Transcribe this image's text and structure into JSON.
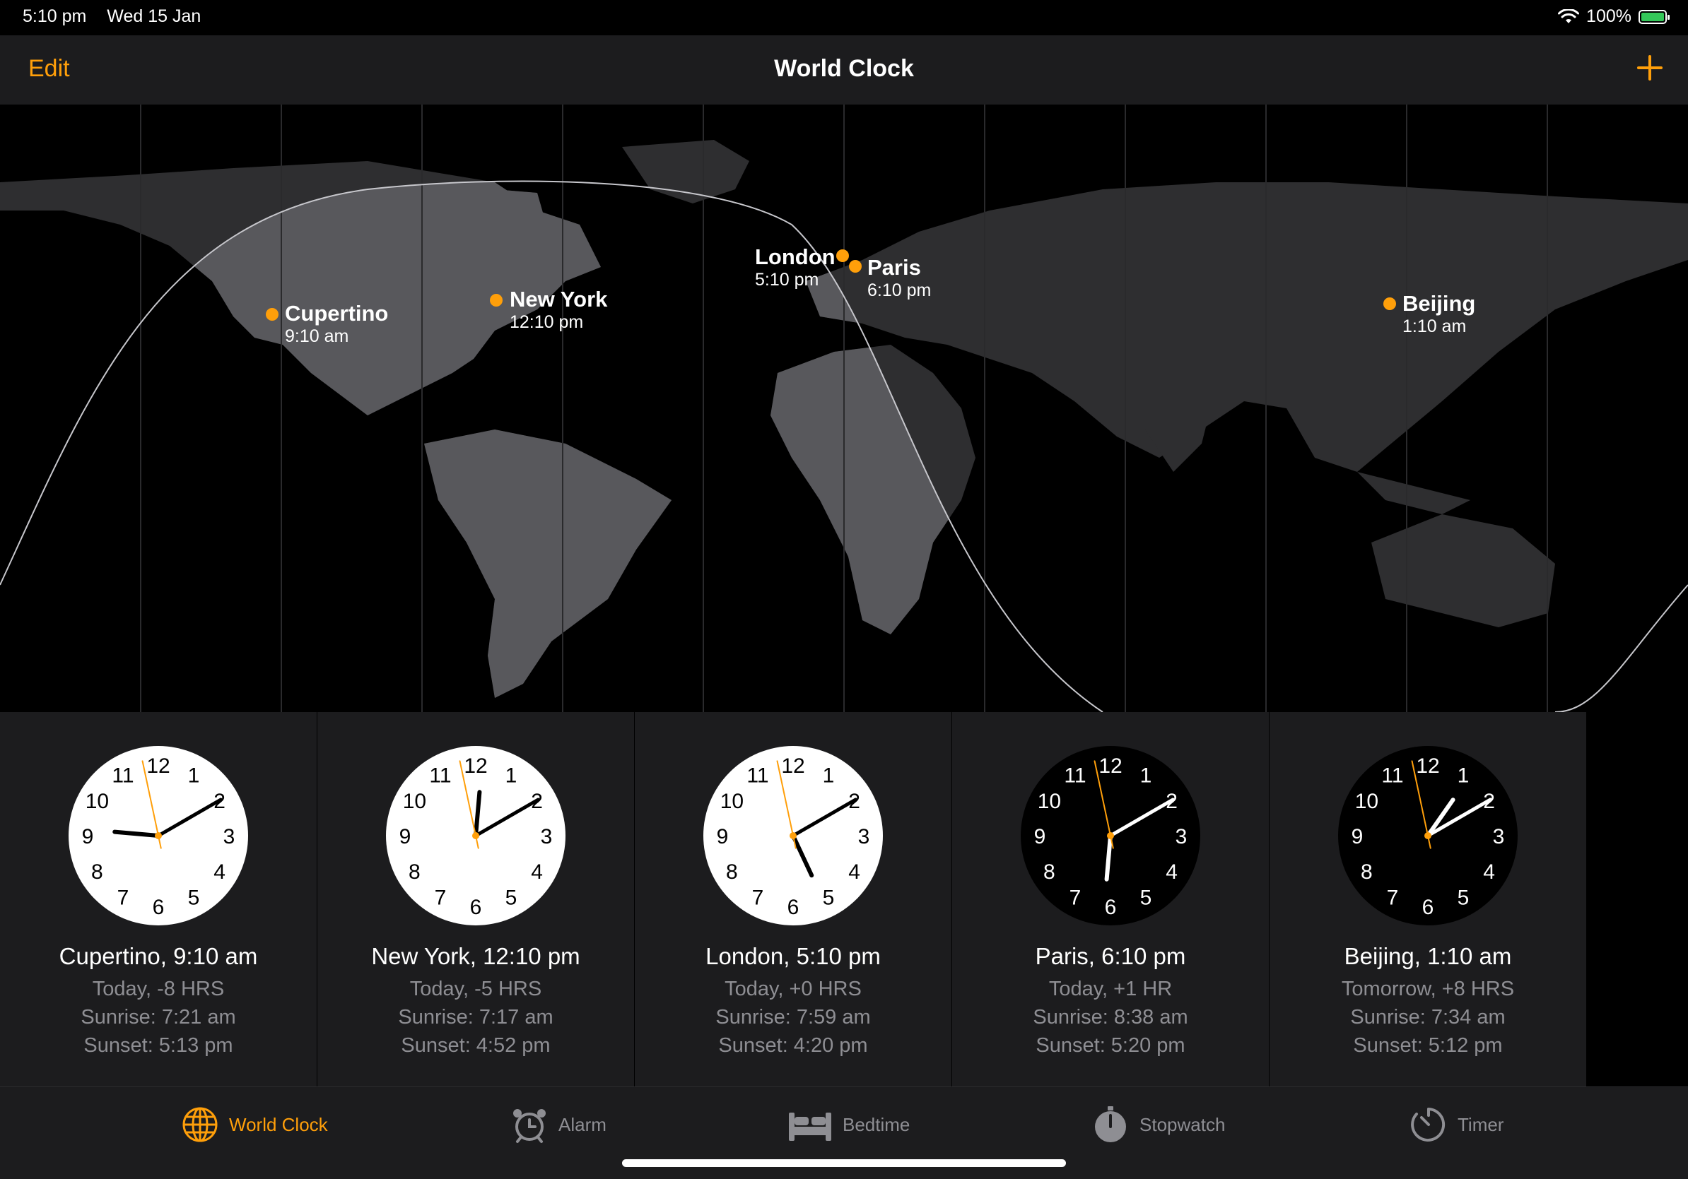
{
  "status": {
    "time": "5:10 pm",
    "date": "Wed 15 Jan",
    "battery": "100%"
  },
  "nav": {
    "edit_label": "Edit",
    "title": "World Clock",
    "add_icon": "plus-icon"
  },
  "map_cities": [
    {
      "name": "Cupertino",
      "time": "9:10 am"
    },
    {
      "name": "New York",
      "time": "12:10 pm"
    },
    {
      "name": "London",
      "time": "5:10 pm"
    },
    {
      "name": "Paris",
      "time": "6:10 pm"
    },
    {
      "name": "Beijing",
      "time": "1:10 am"
    }
  ],
  "clocks": [
    {
      "title": "Cupertino, 9:10 am",
      "offset": "Today, -8 HRS",
      "sunrise": "Sunrise: 7:21 am",
      "sunset": "Sunset: 5:13 pm",
      "hour": 9,
      "minute": 10,
      "second": 58,
      "dark": false
    },
    {
      "title": "New York, 12:10 pm",
      "offset": "Today, -5 HRS",
      "sunrise": "Sunrise: 7:17 am",
      "sunset": "Sunset: 4:52 pm",
      "hour": 12,
      "minute": 10,
      "second": 58,
      "dark": false
    },
    {
      "title": "London, 5:10 pm",
      "offset": "Today, +0 HRS",
      "sunrise": "Sunrise: 7:59 am",
      "sunset": "Sunset: 4:20 pm",
      "hour": 5,
      "minute": 10,
      "second": 58,
      "dark": false
    },
    {
      "title": "Paris, 6:10 pm",
      "offset": "Today, +1 HR",
      "sunrise": "Sunrise: 8:38 am",
      "sunset": "Sunset: 5:20 pm",
      "hour": 6,
      "minute": 10,
      "second": 58,
      "dark": true
    },
    {
      "title": "Beijing, 1:10 am",
      "offset": "Tomorrow, +8 HRS",
      "sunrise": "Sunrise: 7:34 am",
      "sunset": "Sunset: 5:12 pm",
      "hour": 1,
      "minute": 10,
      "second": 58,
      "dark": true
    }
  ],
  "tabs": [
    {
      "label": "World Clock",
      "icon": "globe-icon",
      "active": true
    },
    {
      "label": "Alarm",
      "icon": "alarm-clock-icon",
      "active": false
    },
    {
      "label": "Bedtime",
      "icon": "bed-icon",
      "active": false
    },
    {
      "label": "Stopwatch",
      "icon": "stopwatch-icon",
      "active": false
    },
    {
      "label": "Timer",
      "icon": "timer-icon",
      "active": false
    }
  ],
  "colors": {
    "accent": "#ff9f0a",
    "card_bg": "#1c1c1e",
    "secondary_text": "#8e8e93",
    "land": "#3a3a3c"
  }
}
